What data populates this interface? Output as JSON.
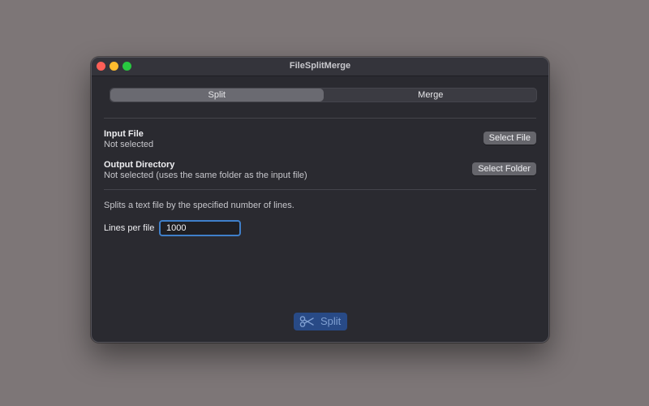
{
  "window": {
    "title": "FileSplitMerge"
  },
  "tabs": [
    {
      "label": "Split",
      "active": true
    },
    {
      "label": "Merge",
      "active": false
    }
  ],
  "input_file": {
    "heading": "Input File",
    "status": "Not selected",
    "button_label": "Select File"
  },
  "output_directory": {
    "heading": "Output Directory",
    "status": "Not selected (uses the same folder as the input file)",
    "button_label": "Select Folder"
  },
  "description": "Splits a text file by the specified number of lines.",
  "lines_per_file": {
    "label": "Lines per file",
    "value": "1000"
  },
  "action": {
    "icon": "scissors-icon",
    "label": "Split"
  },
  "colors": {
    "accent": "#3f7fc9",
    "action_bg": "#284a86",
    "window_bg": "#2a2a30",
    "desktop_bg": "#7d7677"
  }
}
